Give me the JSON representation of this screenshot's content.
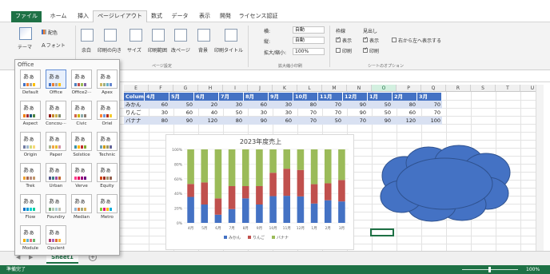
{
  "ribbon_tabs": {
    "file": "ファイル",
    "home": "ホーム",
    "insert": "挿入",
    "page_layout": "ページレイアウト",
    "formulas": "数式",
    "data": "データ",
    "view": "表示",
    "developer": "開発",
    "license": "ライセンス認証"
  },
  "ribbon": {
    "themes": "テーマ",
    "colors": "配色",
    "fonts": "フォント",
    "margins": "余白",
    "orientation": "印刷の向き",
    "size": "サイズ",
    "print_area": "印刷範囲",
    "breaks": "改ページ",
    "background": "背景",
    "print_titles": "印刷タイトル",
    "page_setup_label": "ページ設定",
    "width_label": "横:",
    "height_label": "縦:",
    "scale_label": "拡大/縮小:",
    "width_value": "自動",
    "height_value": "自動",
    "scale_value": "100%",
    "scale_group_label": "拡大縮小印刷",
    "gridlines": "枠線",
    "headings": "見出し",
    "view_label": "表示",
    "print_label": "印刷",
    "rtl": "右から左へ表示する",
    "sheet_options_label": "シートのオプション"
  },
  "gallery": {
    "title": "Office",
    "themes": [
      {
        "name": "Default",
        "selected": false,
        "colors": [
          "#4472c4",
          "#ed7d31",
          "#a5a5a5",
          "#ffc000"
        ]
      },
      {
        "name": "Office",
        "selected": true,
        "colors": [
          "#4472c4",
          "#ed7d31",
          "#a5a5a5",
          "#ffc000"
        ]
      },
      {
        "name": "Office2···",
        "selected": false,
        "colors": [
          "#4f81bd",
          "#c0504d",
          "#9bbb59",
          "#8064a2"
        ]
      },
      {
        "name": "Apex",
        "selected": false,
        "colors": [
          "#ceb966",
          "#9cb084",
          "#6bb1c9",
          "#6585cf"
        ]
      },
      {
        "name": "Aspect",
        "selected": false,
        "colors": [
          "#f07f09",
          "#9f2936",
          "#1b587c",
          "#4e8542"
        ]
      },
      {
        "name": "Concou···",
        "selected": false,
        "colors": [
          "#911819",
          "#c8882a",
          "#c7b14e",
          "#7e8a6f"
        ]
      },
      {
        "name": "Civic",
        "selected": false,
        "colors": [
          "#d16349",
          "#ccb400",
          "#8cadae",
          "#8c7b70"
        ]
      },
      {
        "name": "Oriel",
        "selected": false,
        "colors": [
          "#fe8637",
          "#7598d9",
          "#b32c16",
          "#f5cd2d"
        ]
      },
      {
        "name": "Origin",
        "selected": false,
        "colors": [
          "#727ca3",
          "#9fb8cd",
          "#d2da7a",
          "#fada7a"
        ]
      },
      {
        "name": "Paper",
        "selected": false,
        "colors": [
          "#a5b592",
          "#f3a447",
          "#e7bc29",
          "#d092a7"
        ]
      },
      {
        "name": "Solstice",
        "selected": false,
        "colors": [
          "#3891a7",
          "#feb80a",
          "#c32d2e",
          "#84aa33"
        ]
      },
      {
        "name": "Technic",
        "selected": false,
        "colors": [
          "#6ea0b0",
          "#cc9900",
          "#999966",
          "#666699"
        ]
      },
      {
        "name": "Trek",
        "selected": false,
        "colors": [
          "#f0a22e",
          "#a5644e",
          "#b58b80",
          "#c3986d"
        ]
      },
      {
        "name": "Urban",
        "selected": false,
        "colors": [
          "#53548a",
          "#438086",
          "#a04da3",
          "#c4652d"
        ]
      },
      {
        "name": "Verve",
        "selected": false,
        "colors": [
          "#ff388c",
          "#e40059",
          "#9c007f",
          "#68007f"
        ]
      },
      {
        "name": "Equity",
        "selected": false,
        "colors": [
          "#d34817",
          "#9b2d1f",
          "#a28e6a",
          "#956251"
        ]
      },
      {
        "name": "Flow",
        "selected": false,
        "colors": [
          "#0f6fc6",
          "#009dd9",
          "#0bd0d9",
          "#10cf9b"
        ]
      },
      {
        "name": "Foundry",
        "selected": false,
        "colors": [
          "#72a376",
          "#b0ccb0",
          "#a8cdd7",
          "#c0beaf"
        ]
      },
      {
        "name": "Median",
        "selected": false,
        "colors": [
          "#94b6d2",
          "#dd8047",
          "#a5ab81",
          "#d8b25c"
        ]
      },
      {
        "name": "Metro",
        "selected": false,
        "colors": [
          "#7fd13b",
          "#ea157a",
          "#feb80a",
          "#00addc"
        ]
      },
      {
        "name": "Module",
        "selected": false,
        "colors": [
          "#f0ad00",
          "#60b5cc",
          "#e66c7d",
          "#6bb76d"
        ]
      },
      {
        "name": "Opulent",
        "selected": false,
        "colors": [
          "#b83d68",
          "#ac66bb",
          "#de6c36",
          "#f9b639"
        ]
      }
    ]
  },
  "grid": {
    "columns": [
      "E",
      "F",
      "G",
      "H",
      "I",
      "J",
      "K",
      "L",
      "M",
      "N",
      "O",
      "P",
      "Q",
      "R",
      "S",
      "T",
      "U"
    ],
    "selected_column": "O"
  },
  "table": {
    "headers": [
      "Colum",
      "4月",
      "5月",
      "6月",
      "7月",
      "8月",
      "9月",
      "10月",
      "11月",
      "12月",
      "1月",
      "2月",
      "3月"
    ],
    "rows": [
      [
        "みかん",
        "60",
        "50",
        "20",
        "30",
        "60",
        "30",
        "80",
        "70",
        "90",
        "50",
        "80",
        "70"
      ],
      [
        "りんご",
        "30",
        "60",
        "40",
        "50",
        "30",
        "30",
        "70",
        "70",
        "90",
        "50",
        "60",
        "70"
      ],
      [
        "バナナ",
        "80",
        "90",
        "120",
        "80",
        "90",
        "60",
        "70",
        "50",
        "70",
        "90",
        "120",
        "100"
      ]
    ]
  },
  "chart_data": {
    "type": "bar",
    "stacked": "percent",
    "title": "2023年度売上",
    "categories": [
      "4月",
      "5月",
      "6月",
      "7月",
      "8月",
      "9月",
      "10月",
      "11月",
      "12月",
      "1月",
      "2月",
      "3月"
    ],
    "series": [
      {
        "name": "みかん",
        "color": "#4472c4",
        "values": [
          60,
          50,
          20,
          30,
          60,
          30,
          80,
          70,
          90,
          50,
          80,
          70
        ]
      },
      {
        "name": "りんご",
        "color": "#c0504d",
        "values": [
          30,
          60,
          40,
          50,
          30,
          30,
          70,
          70,
          90,
          50,
          60,
          70
        ]
      },
      {
        "name": "バナナ",
        "color": "#9bbb59",
        "values": [
          80,
          90,
          120,
          80,
          90,
          60,
          70,
          50,
          70,
          90,
          120,
          100
        ]
      }
    ],
    "y_ticks": [
      "0%",
      "20%",
      "40%",
      "60%",
      "80%",
      "100%"
    ],
    "ylim": [
      0,
      100
    ],
    "legend_position": "bottom"
  },
  "sheet_tab": "Sheet1",
  "status": {
    "ready": "準備完了",
    "zoom": "100%"
  },
  "colors": {
    "excel_green": "#1e7145",
    "table_header": "#4472c4",
    "table_band": "#d9e1f2",
    "cloud": "#4472c4"
  }
}
